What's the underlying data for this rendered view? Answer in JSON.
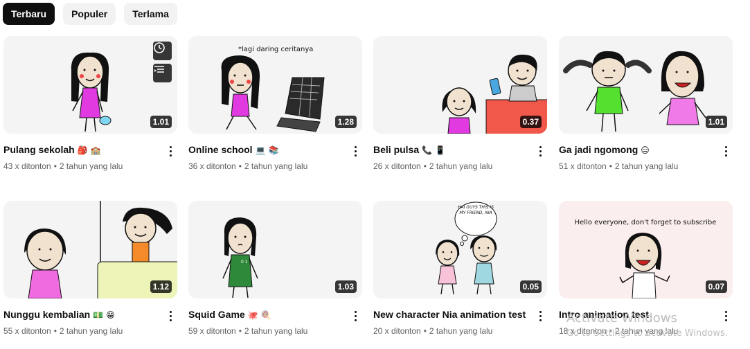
{
  "filters": [
    "Terbaru",
    "Populer",
    "Terlama"
  ],
  "videos": [
    {
      "title": "Pulang sekolah",
      "emoji": "🎒 🏫",
      "views": "43 x ditonton",
      "age": "2 tahun yang lalu",
      "duration": "1.01"
    },
    {
      "title": "Online school",
      "emoji": "💻 📚",
      "views": "36 x ditonton",
      "age": "2 tahun yang lalu",
      "duration": "1.28",
      "thumb_text": "*lagi daring ceritanya"
    },
    {
      "title": "Beli pulsa",
      "emoji": "📞 📱",
      "views": "26 x ditonton",
      "age": "2 tahun yang lalu",
      "duration": "0.37"
    },
    {
      "title": "Ga jadi ngomong",
      "emoji": "😑",
      "views": "51 x ditonton",
      "age": "2 tahun yang lalu",
      "duration": "1.01"
    },
    {
      "title": "Nunggu kembalian",
      "emoji": "💵 😁",
      "views": "55 x ditonton",
      "age": "2 tahun yang lalu",
      "duration": "1.12"
    },
    {
      "title": "Squid Game",
      "emoji": "🐙 🍭",
      "views": "59 x ditonton",
      "age": "2 tahun yang lalu",
      "duration": "1.03"
    },
    {
      "title": "New character Nia animation test",
      "emoji": "",
      "views": "20 x ditonton",
      "age": "2 tahun yang lalu",
      "duration": "0.05",
      "thumb_text": "HAI GUYS THIS IS MY FRIEND, NIA"
    },
    {
      "title": "Intro animation test",
      "emoji": "",
      "views": "18 x ditonton",
      "age": "2 tahun yang lalu",
      "duration": "0.07",
      "thumb_text": "Hello everyone, don't forget to subscribe"
    }
  ],
  "separator": "•",
  "watermark": {
    "line1": "Activate Windows",
    "line2": "Go to Settings to activate Windows."
  },
  "colors": {
    "chip_active": "#0f0f0f",
    "chip_inactive": "#f2f2f2",
    "meta": "#606060"
  }
}
